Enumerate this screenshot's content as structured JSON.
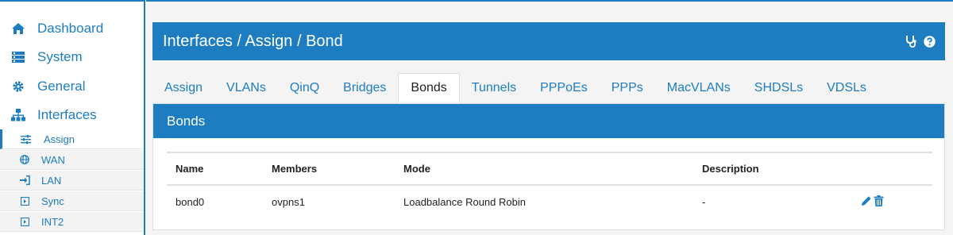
{
  "sidebar": {
    "main": [
      {
        "label": "Dashboard",
        "icon": "home-icon"
      },
      {
        "label": "System",
        "icon": "server-icon"
      },
      {
        "label": "General",
        "icon": "gear-icon"
      },
      {
        "label": "Interfaces",
        "icon": "sitemap-icon"
      }
    ],
    "sub": [
      {
        "label": "Assign",
        "icon": "sliders-icon"
      },
      {
        "label": "WAN",
        "icon": "globe-icon"
      },
      {
        "label": "LAN",
        "icon": "sign-in-icon"
      },
      {
        "label": "Sync",
        "icon": "box-arrow-icon"
      },
      {
        "label": "INT2",
        "icon": "box-arrow-icon"
      }
    ]
  },
  "header": {
    "title": "Interfaces / Assign / Bond"
  },
  "tabs": [
    "Assign",
    "VLANs",
    "QinQ",
    "Bridges",
    "Bonds",
    "Tunnels",
    "PPPoEs",
    "PPPs",
    "MacVLANs",
    "SHDSLs",
    "VDSLs"
  ],
  "panel": {
    "title": "Bonds"
  },
  "table": {
    "columns": [
      "Name",
      "Members",
      "Mode",
      "Description"
    ],
    "rows": [
      {
        "name": "bond0",
        "members": "ovpns1",
        "mode": "Loadbalance Round Robin",
        "description": "-"
      }
    ]
  },
  "colors": {
    "accent": "#1e7dc0"
  }
}
